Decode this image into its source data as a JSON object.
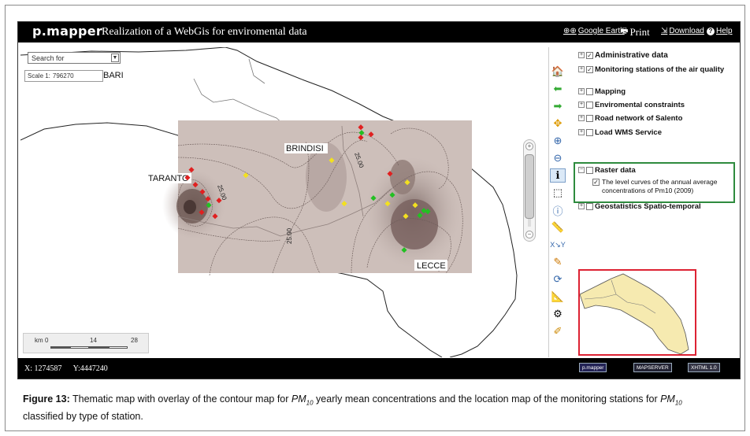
{
  "header": {
    "logo": "p.mapper",
    "title": "Realization of a WebGis for enviromental data",
    "links": {
      "google_earth": "Google Earth",
      "print": "Print",
      "download": "Download",
      "help": "Help"
    }
  },
  "map": {
    "search_placeholder": "Search for",
    "scale_label": "Scale 1:",
    "scale_value": "796270",
    "place_labels": {
      "bari": "BARI",
      "taranto": "TARANTO",
      "brindisi": "BRINDISI",
      "lecce": "LECCE"
    },
    "contour_labels": [
      "25.00",
      "25.00",
      "25.00"
    ],
    "scalebar": {
      "unit": "km",
      "ticks": [
        "0",
        "14",
        "28"
      ]
    }
  },
  "layers": {
    "items": [
      {
        "label": "Administrative data",
        "checked": true
      },
      {
        "label": "Monitoring stations of the air quality",
        "checked": true
      },
      {
        "label": "Mapping",
        "checked": false
      },
      {
        "label": "Enviromental constraints",
        "checked": false
      },
      {
        "label": "Road network of Salento",
        "checked": false
      },
      {
        "label": "Load WMS Service",
        "checked": false
      },
      {
        "label": "Raster data",
        "checked": false
      },
      {
        "label": "Geostatistics Spatio-temporal",
        "checked": false
      }
    ],
    "raster_sublayer": {
      "label": "The level curves of the annual average concentrations of Pm10 (2009)",
      "checked": true
    }
  },
  "statusbar": {
    "x": "X: 1274587",
    "y": "Y:4447240",
    "badges": [
      "p.mapper",
      "MAPSERVER",
      "XHTML 1.0"
    ]
  },
  "caption": {
    "prefix": "Figure 13:",
    "part1": " Thematic map with overlay of the contour map for ",
    "pm": "PM",
    "sub": "10",
    "part2": " yearly mean concentrations and the location map of the monitoring stations for ",
    "part3": "classified by type of station."
  },
  "colors": {
    "bar_bg": "#000000",
    "highlight_green": "#2e8b3e",
    "overview_red": "#dd2233",
    "station_red": "#e02020",
    "station_yellow": "#f2e020",
    "station_green": "#22c022"
  }
}
